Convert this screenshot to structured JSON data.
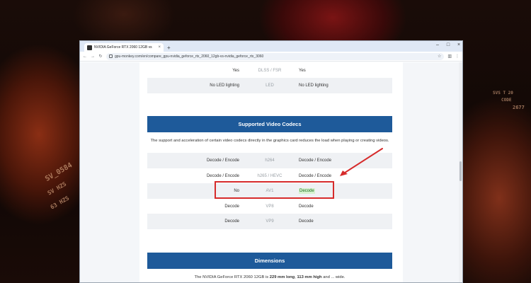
{
  "window": {
    "tab_title": "NVIDIA GeForce RTX 2060 12GB vs",
    "tab_close": "×",
    "new_tab": "+",
    "controls": {
      "minimize": "–",
      "maximize": "□",
      "close": "×"
    }
  },
  "toolbar": {
    "back": "←",
    "forward": "→",
    "reload": "↻",
    "url": "gpu-monkey.com/en/compare_gpu-nvidia_geforce_rtx_2060_12gb-vs-nvidia_geforce_rtx_3060",
    "star": "☆",
    "sidebar_icon": "▥",
    "menu_icon": "⋮"
  },
  "icons": {
    "favicon": "favicon-icon",
    "lock": "lock-icon",
    "bookmark": "star-icon"
  },
  "top_rows": [
    {
      "left": "Yes",
      "middle": "DLSS / FSR",
      "right": "Yes"
    },
    {
      "left": "No LED lighting",
      "middle": "LED",
      "right": "No LED lighting"
    }
  ],
  "codecs": {
    "title": "Supported Video Codecs",
    "description": "The support and acceleration of certain video codecs directly in the graphics card reduces the load when playing or creating videos.",
    "rows": [
      {
        "left": "Decode / Encode",
        "middle": "h264",
        "right": "Decode / Encode"
      },
      {
        "left": "Decode / Encode",
        "middle": "h265 / HEVC",
        "right": "Decode / Encode"
      },
      {
        "left": "No",
        "middle": "AV1",
        "right": "Decode"
      },
      {
        "left": "Decode",
        "middle": "VP8",
        "right": "Decode"
      },
      {
        "left": "Decode",
        "middle": "VP9",
        "right": "Decode"
      }
    ]
  },
  "dimensions": {
    "title": "Dimensions",
    "text_prefix": "The NVIDIA GeForce RTX 2060 12GB is",
    "length": "229 mm long",
    "text_sep": ",",
    "height": "113 mm high",
    "text_suffix": "and ... wide."
  },
  "wallpaper_text": {
    "left_1": "SV_0584",
    "left_2": "SV HZS",
    "left_3": "63 HZS",
    "right_1": "SVS T 20",
    "right_2": "CODE",
    "right_3": "2677"
  },
  "colors": {
    "section_header": "#1e5a9a",
    "decode_badge_bg": "#d6f2d0",
    "annotation_red": "#d62b2b"
  }
}
